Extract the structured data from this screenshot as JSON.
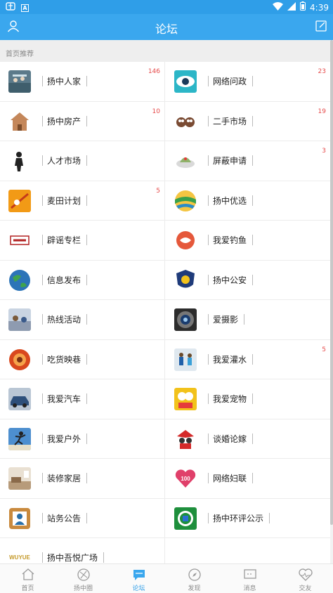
{
  "status_bar": {
    "time": "4:39"
  },
  "header": {
    "title": "论坛"
  },
  "section": {
    "label": "首页推荐"
  },
  "forum_rows": [
    {
      "left": {
        "label": "扬中人家",
        "count": "146",
        "icon": "family-photo-icon",
        "color": "#5b7a8a"
      },
      "right": {
        "label": "网络问政",
        "count": "23",
        "icon": "eye-icon",
        "color": "#2cb6c7"
      }
    },
    {
      "left": {
        "label": "扬中房产",
        "count": "10",
        "icon": "house-icon",
        "color": "#c4875a"
      },
      "right": {
        "label": "二手市场",
        "count": "19",
        "icon": "owls-icon",
        "color": "#7a4b33"
      }
    },
    {
      "left": {
        "label": "人才市场",
        "count": "",
        "icon": "person-silhouette-icon",
        "color": "#222222"
      },
      "right": {
        "label": "屏蔽申请",
        "count": "3",
        "icon": "shield-bowl-icon",
        "color": "#8fb26a"
      }
    },
    {
      "left": {
        "label": "麦田计划",
        "count": "5",
        "icon": "field-plan-icon",
        "color": "#f29a16"
      },
      "right": {
        "label": "扬中优选",
        "count": "",
        "icon": "globe-stripes-icon",
        "color": "#3aa14b"
      }
    },
    {
      "left": {
        "label": "辟谣专栏",
        "count": "",
        "icon": "rumor-stamp-icon",
        "color": "#b22222"
      },
      "right": {
        "label": "我爱钓鱼",
        "count": "",
        "icon": "fish-logo-icon",
        "color": "#e5583b"
      }
    },
    {
      "left": {
        "label": "信息发布",
        "count": "",
        "icon": "earth-icon",
        "color": "#2c74b8"
      },
      "right": {
        "label": "扬中公安",
        "count": "",
        "icon": "police-badge-icon",
        "color": "#1f3b7a"
      }
    },
    {
      "left": {
        "label": "热线活动",
        "count": "",
        "icon": "event-photo-icon",
        "color": "#8e9bb0"
      },
      "right": {
        "label": "爱摄影",
        "count": "",
        "icon": "camera-lens-icon",
        "color": "#3a3a3a"
      }
    },
    {
      "left": {
        "label": "吃货映巷",
        "count": "",
        "icon": "food-plate-icon",
        "color": "#d9481e"
      },
      "right": {
        "label": "我爱灌水",
        "count": "5",
        "icon": "kids-photo-icon",
        "color": "#5aa0d8"
      }
    },
    {
      "left": {
        "label": "我爱汽车",
        "count": "",
        "icon": "car-icon",
        "color": "#2d4f7a"
      },
      "right": {
        "label": "我爱宠物",
        "count": "",
        "icon": "pets-icon",
        "color": "#f2c21b"
      }
    },
    {
      "left": {
        "label": "我爱户外",
        "count": "",
        "icon": "jumping-person-icon",
        "color": "#4d8fcf"
      },
      "right": {
        "label": "谈婚论嫁",
        "count": "",
        "icon": "wedding-couple-icon",
        "color": "#d42a2a"
      }
    },
    {
      "left": {
        "label": "装修家居",
        "count": "",
        "icon": "room-interior-icon",
        "color": "#b79b7a"
      },
      "right": {
        "label": "网络妇联",
        "count": "",
        "icon": "heart-100-icon",
        "color": "#e0406a"
      }
    },
    {
      "left": {
        "label": "站务公告",
        "count": "",
        "icon": "profile-card-icon",
        "color": "#c98a3e"
      },
      "right": {
        "label": "扬中环评公示",
        "count": "",
        "icon": "eco-seal-icon",
        "color": "#1e8f3c"
      }
    },
    {
      "left": {
        "label": "扬中吾悦广场",
        "count": "",
        "icon": "wuyue-logo-icon",
        "color": "#c59a2a"
      },
      "right": null
    }
  ],
  "tabs": [
    {
      "label": "首页",
      "icon": "home-icon"
    },
    {
      "label": "扬中圈",
      "icon": "circle-icon"
    },
    {
      "label": "论坛",
      "icon": "chat-bubble-icon",
      "active": true
    },
    {
      "label": "发现",
      "icon": "compass-icon"
    },
    {
      "label": "消息",
      "icon": "message-icon"
    },
    {
      "label": "交友",
      "icon": "heart-icon"
    }
  ],
  "colors": {
    "primary": "#3aa7ee",
    "badge": "#e64a4a"
  }
}
